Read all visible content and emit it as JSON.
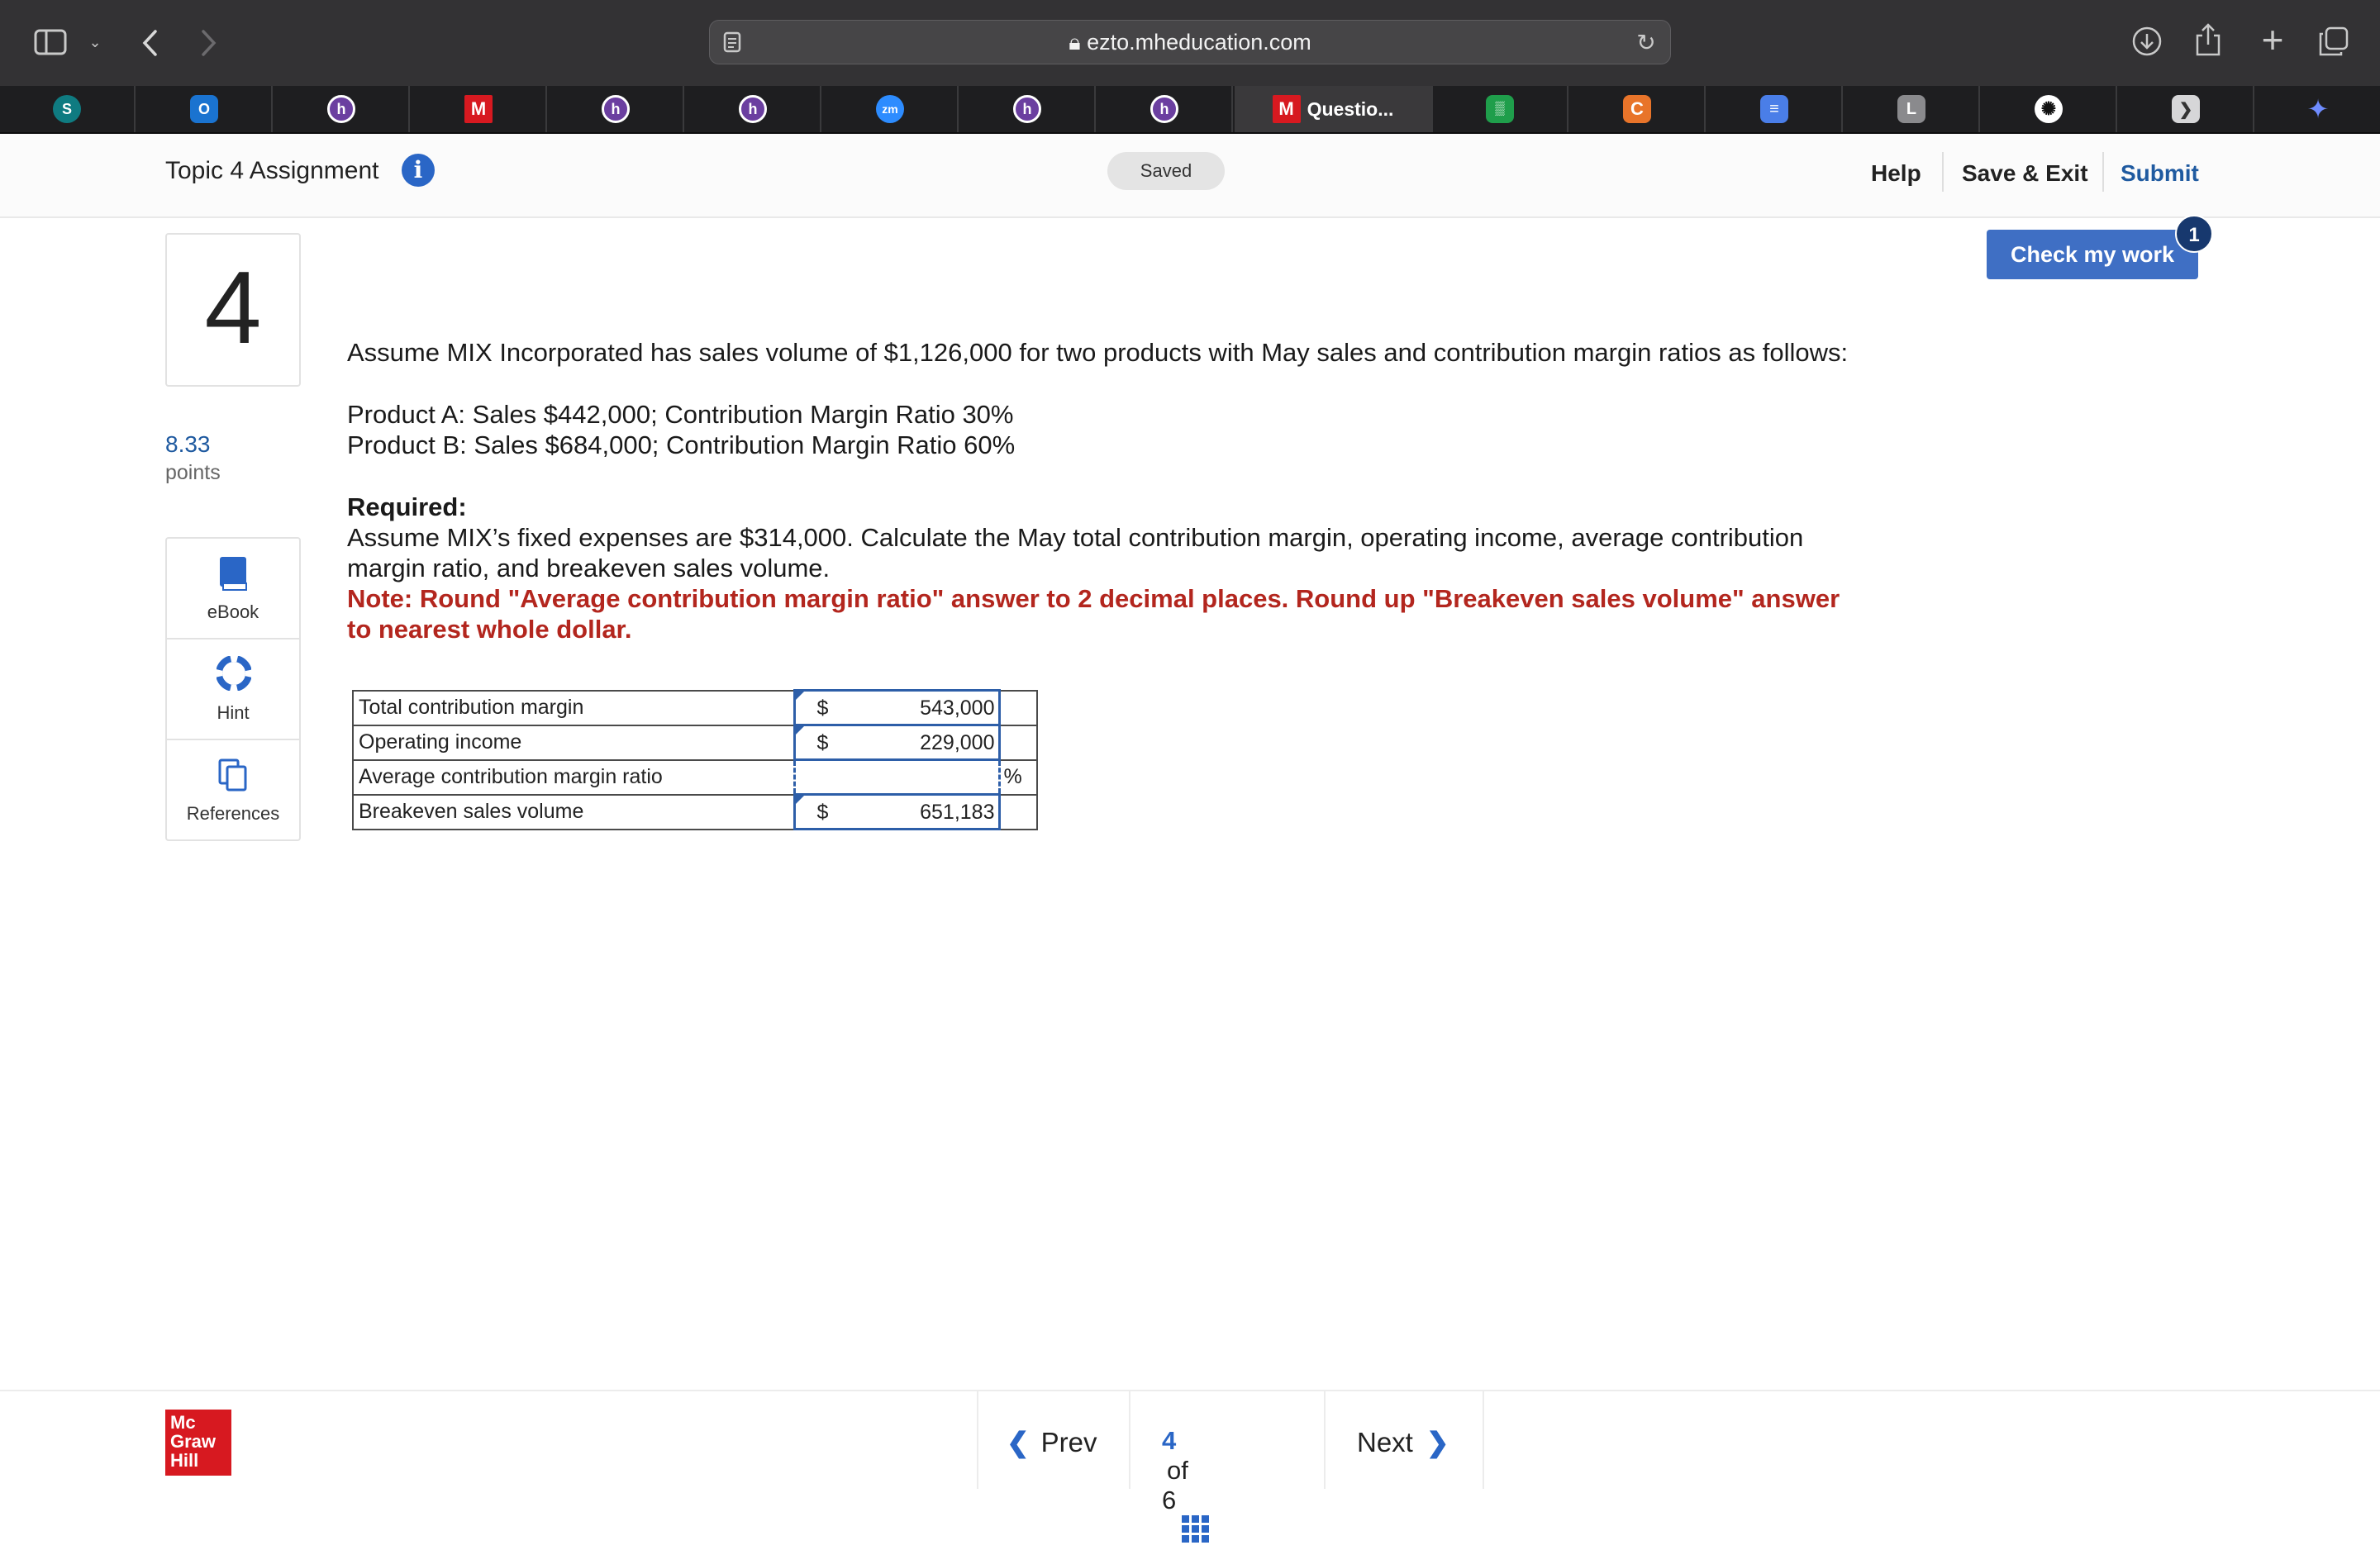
{
  "browser": {
    "url": "ezto.mheducation.com",
    "tabs": [
      {
        "icon": "sharepoint-icon",
        "label": ""
      },
      {
        "icon": "outlook-icon",
        "label": ""
      },
      {
        "icon": "h-icon",
        "label": ""
      },
      {
        "icon": "m-icon",
        "label": ""
      },
      {
        "icon": "h-icon",
        "label": ""
      },
      {
        "icon": "h-icon",
        "label": ""
      },
      {
        "icon": "zoom-icon",
        "label": ""
      },
      {
        "icon": "h-icon",
        "label": ""
      },
      {
        "icon": "h-icon",
        "label": ""
      },
      {
        "icon": "m-icon",
        "label": "Questio..."
      },
      {
        "icon": "calculator-icon",
        "label": ""
      },
      {
        "icon": "c-icon",
        "label": ""
      },
      {
        "icon": "docs-icon",
        "label": ""
      },
      {
        "icon": "l-icon",
        "label": ""
      },
      {
        "icon": "chatgpt-icon",
        "label": ""
      },
      {
        "icon": "arrow-tab-icon",
        "label": ""
      },
      {
        "icon": "sparkle-icon",
        "label": ""
      }
    ]
  },
  "header": {
    "title": "Topic 4 Assignment",
    "saved": "Saved",
    "help": "Help",
    "save_exit": "Save & Exit",
    "submit": "Submit"
  },
  "question": {
    "number": "4",
    "points_value": "8.33",
    "points_label": "points",
    "intro": "Assume MIX Incorporated has sales volume of $1,126,000 for two products with May sales and contribution margin ratios as follows:",
    "product_a": "Product A: Sales $442,000; Contribution Margin Ratio 30%",
    "product_b": "Product B: Sales $684,000; Contribution Margin Ratio 60%",
    "required_label": "Required:",
    "required_text": "Assume MIX’s fixed expenses are $314,000. Calculate the May total contribution margin, operating income, average contribution margin ratio, and breakeven sales volume.",
    "note": "Note: Round \"Average contribution margin ratio\" answer to 2 decimal places. Round up \"Breakeven sales volume\" answer to nearest whole dollar."
  },
  "tools": {
    "ebook": "eBook",
    "hint": "Hint",
    "references": "References"
  },
  "answer_table": {
    "rows": [
      {
        "label": "Total contribution margin",
        "prefix": "$",
        "value": "543,000",
        "suffix": ""
      },
      {
        "label": "Operating income",
        "prefix": "$",
        "value": "229,000",
        "suffix": ""
      },
      {
        "label": "Average contribution margin ratio",
        "prefix": "",
        "value": "",
        "suffix": "%"
      },
      {
        "label": "Breakeven sales volume",
        "prefix": "$",
        "value": "651,183",
        "suffix": ""
      }
    ]
  },
  "check_work": {
    "label": "Check my work",
    "badge": "1"
  },
  "footer": {
    "logo": "Mc Graw Hill",
    "prev": "Prev",
    "page_current": "4",
    "page_of": "of",
    "page_total": "6",
    "next": "Next"
  },
  "colors": {
    "accent": "#3f6fc4",
    "note_red": "#b3261e",
    "logo_red": "#d71920"
  }
}
